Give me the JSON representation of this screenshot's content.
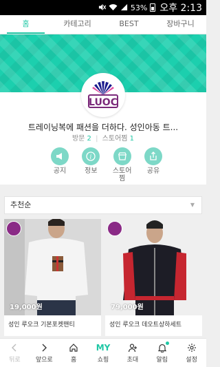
{
  "status_bar": {
    "battery_pct": "53%",
    "time": "오후 2:13"
  },
  "tabs": [
    {
      "label": "홈",
      "active": true
    },
    {
      "label": "카테고리",
      "active": false
    },
    {
      "label": "BEST",
      "active": false
    },
    {
      "label": "장바구니",
      "active": false
    }
  ],
  "store": {
    "logo_text": "LUOC",
    "name": "트레이닝복에 패션을 더하다. 성인아동 트...",
    "visits_label": "방문",
    "visits_count": "2",
    "favorites_label": "스토어찜",
    "favorites_count": "1"
  },
  "actions": [
    {
      "label": "공지",
      "icon": "megaphone-icon"
    },
    {
      "label": "정보",
      "icon": "info-icon"
    },
    {
      "label": "스토어찜",
      "icon": "store-favorite-icon"
    },
    {
      "label": "공유",
      "icon": "share-icon"
    }
  ],
  "sort": {
    "selected": "추천순"
  },
  "products": [
    {
      "price": "19,000원",
      "name": "성인 루오크 기본포켓맨티"
    },
    {
      "price": "79,000원",
      "name": "성인 루오크 데오트상하세트"
    }
  ],
  "bottom_nav": [
    {
      "label": "뒤로",
      "icon": "back-icon"
    },
    {
      "label": "앞으로",
      "icon": "forward-icon"
    },
    {
      "label": "홈",
      "icon": "home-icon"
    },
    {
      "label": "쇼핑",
      "icon": "my-shopping-icon",
      "icon_text": "MY"
    },
    {
      "label": "초대",
      "icon": "invite-icon"
    },
    {
      "label": "알림",
      "icon": "bell-icon"
    },
    {
      "label": "설정",
      "icon": "gear-icon"
    }
  ],
  "colors": {
    "accent": "#1fc7a5",
    "hero": "#1ccfae",
    "brand_purple": "#7b2a7a"
  }
}
